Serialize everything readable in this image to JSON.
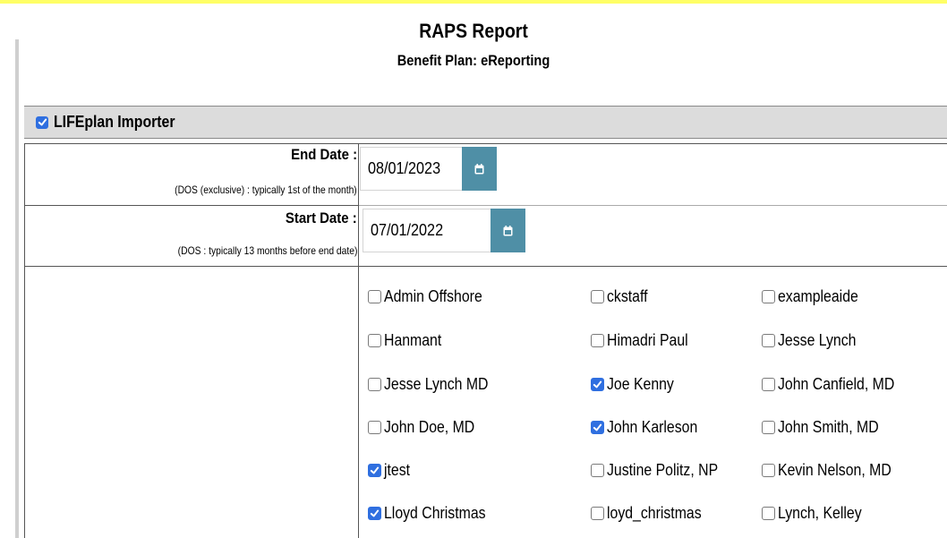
{
  "report": {
    "title": "RAPS Report",
    "subtitle": "Benefit Plan: eReporting"
  },
  "section": {
    "label": "LIFEplan Importer",
    "checked": true
  },
  "end_date": {
    "label": "End Date :",
    "hint": "(DOS (exclusive) : typically 1st of the month)",
    "value": "08/01/2023",
    "icon": "calendar-icon"
  },
  "start_date": {
    "label": "Start Date :",
    "hint": "(DOS : typically 13 months before end date)",
    "value": "07/01/2022",
    "icon": "calendar-icon"
  },
  "users": [
    {
      "name": "Admin Offshore",
      "checked": false
    },
    {
      "name": "ckstaff",
      "checked": false
    },
    {
      "name": "exampleaide",
      "checked": false
    },
    {
      "name": "Hanmant",
      "checked": false
    },
    {
      "name": "Himadri Paul",
      "checked": false
    },
    {
      "name": "Jesse Lynch",
      "checked": false
    },
    {
      "name": "Jesse Lynch MD",
      "checked": false
    },
    {
      "name": "Joe Kenny",
      "checked": true
    },
    {
      "name": "John Canfield, MD",
      "checked": false
    },
    {
      "name": "John Doe, MD",
      "checked": false
    },
    {
      "name": "John Karleson",
      "checked": true
    },
    {
      "name": "John Smith, MD",
      "checked": false
    },
    {
      "name": "jtest",
      "checked": true
    },
    {
      "name": "Justine Politz, NP",
      "checked": false
    },
    {
      "name": "Kevin Nelson, MD",
      "checked": false
    },
    {
      "name": "Lloyd Christmas",
      "checked": true
    },
    {
      "name": "loyd_christmas",
      "checked": false
    },
    {
      "name": "Lynch, Kelley",
      "checked": false
    }
  ],
  "colors": {
    "checkbox_checked": "#2f6fe0",
    "calendar_button": "#4f8fa6",
    "section_bar": "#dcdcdc",
    "top_border": "#ffff66"
  }
}
